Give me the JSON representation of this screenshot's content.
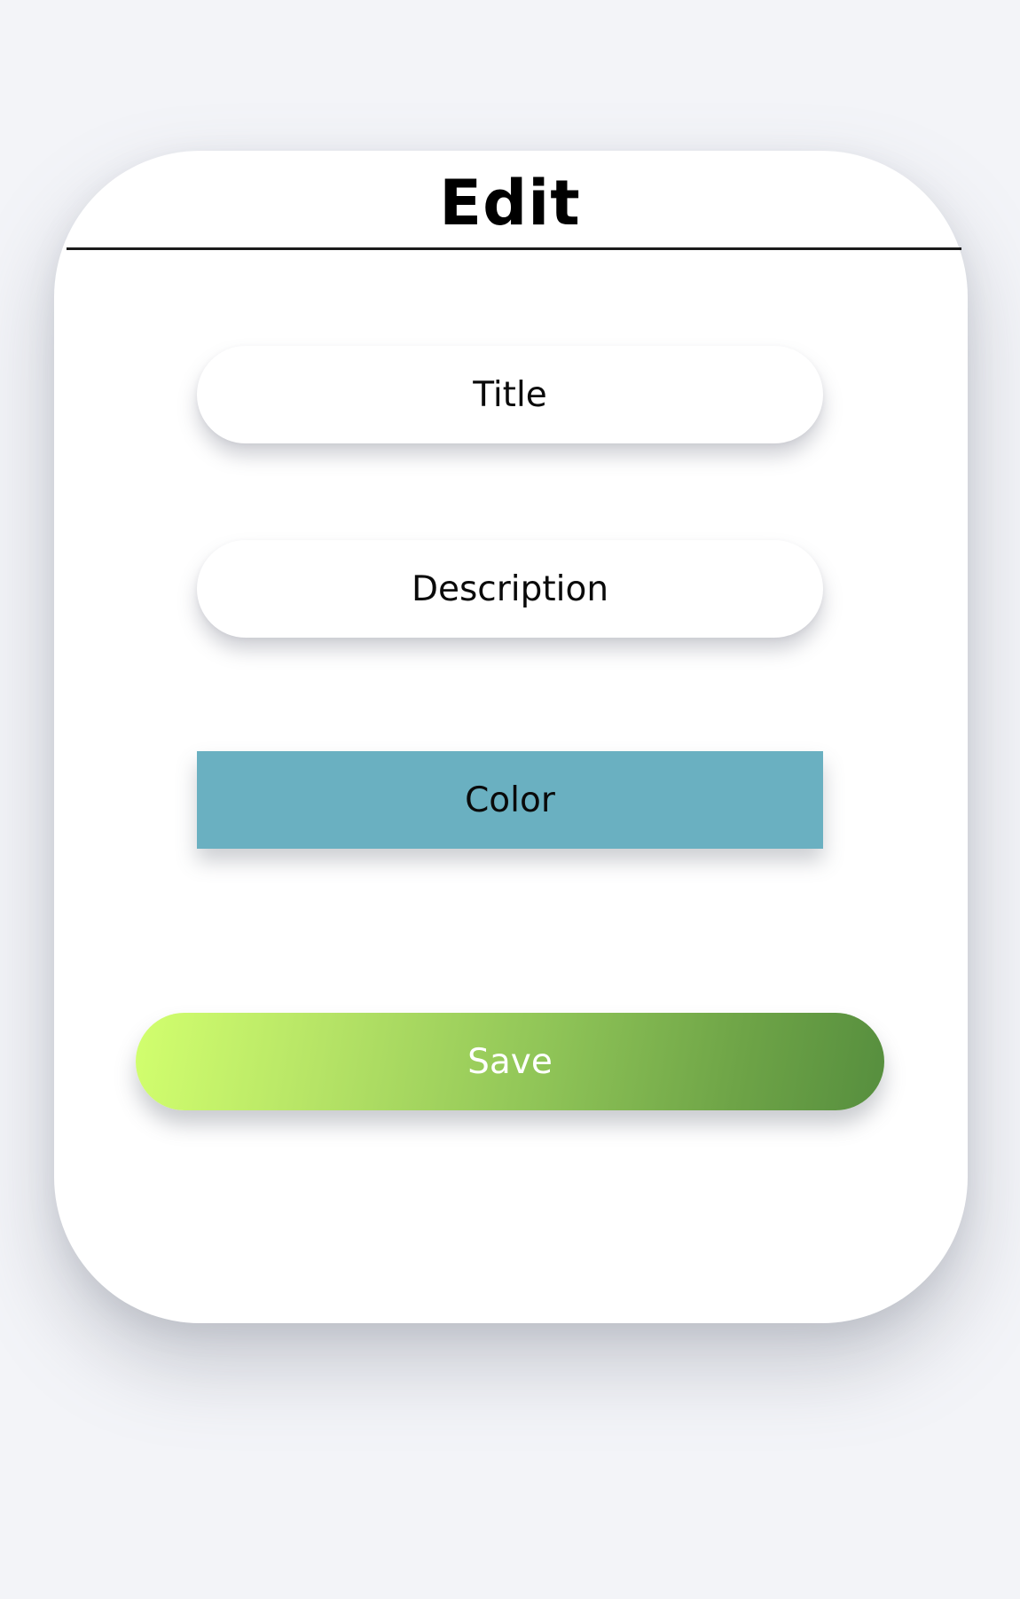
{
  "header": {
    "title": "Edit"
  },
  "form": {
    "title_label": "Title",
    "description_label": "Description",
    "color_label": "Color",
    "save_label": "Save"
  },
  "colors": {
    "background": "#f3f4f8",
    "card": "#ffffff",
    "color_button": "#6ab0c1",
    "save_gradient_start": "#d2ff6e",
    "save_gradient_end": "#568e3e"
  }
}
